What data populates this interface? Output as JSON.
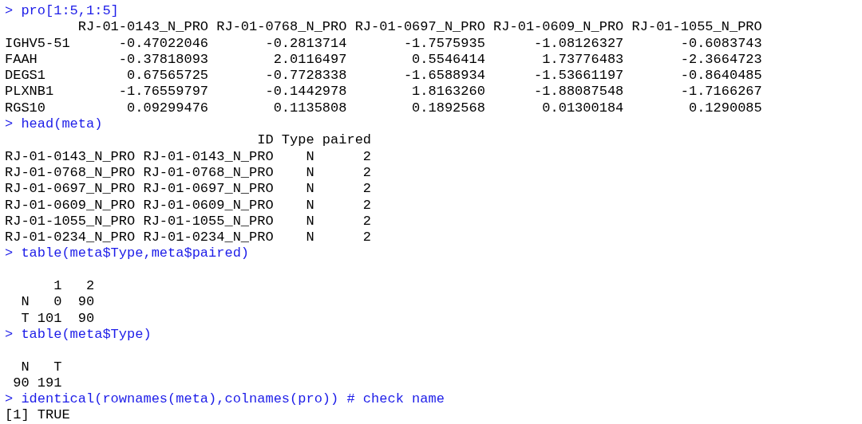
{
  "console": {
    "lines": [
      {
        "kind": "input",
        "text": "> pro[1:5,1:5]"
      },
      {
        "kind": "output",
        "text": "         RJ-01-0143_N_PRO RJ-01-0768_N_PRO RJ-01-0697_N_PRO RJ-01-0609_N_PRO RJ-01-1055_N_PRO"
      },
      {
        "kind": "output",
        "text": "IGHV5-51      -0.47022046       -0.2813714       -1.7575935      -1.08126327       -0.6083743"
      },
      {
        "kind": "output",
        "text": "FAAH          -0.37818093        2.0116497        0.5546414       1.73776483       -2.3664723"
      },
      {
        "kind": "output",
        "text": "DEGS1          0.67565725       -0.7728338       -1.6588934      -1.53661197       -0.8640485"
      },
      {
        "kind": "output",
        "text": "PLXNB1        -1.76559797       -0.1442978        1.8163260      -1.88087548       -1.7166267"
      },
      {
        "kind": "output",
        "text": "RGS10          0.09299476        0.1135808        0.1892568       0.01300184        0.1290085"
      },
      {
        "kind": "input",
        "text": "> head(meta)"
      },
      {
        "kind": "output",
        "text": "                               ID Type paired"
      },
      {
        "kind": "output",
        "text": "RJ-01-0143_N_PRO RJ-01-0143_N_PRO    N      2"
      },
      {
        "kind": "output",
        "text": "RJ-01-0768_N_PRO RJ-01-0768_N_PRO    N      2"
      },
      {
        "kind": "output",
        "text": "RJ-01-0697_N_PRO RJ-01-0697_N_PRO    N      2"
      },
      {
        "kind": "output",
        "text": "RJ-01-0609_N_PRO RJ-01-0609_N_PRO    N      2"
      },
      {
        "kind": "output",
        "text": "RJ-01-1055_N_PRO RJ-01-1055_N_PRO    N      2"
      },
      {
        "kind": "output",
        "text": "RJ-01-0234_N_PRO RJ-01-0234_N_PRO    N      2"
      },
      {
        "kind": "input",
        "text": "> table(meta$Type,meta$paired)"
      },
      {
        "kind": "blank"
      },
      {
        "kind": "output",
        "text": "      1   2"
      },
      {
        "kind": "output",
        "text": "  N   0  90"
      },
      {
        "kind": "output",
        "text": "  T 101  90"
      },
      {
        "kind": "input",
        "text": "> table(meta$Type)"
      },
      {
        "kind": "blank"
      },
      {
        "kind": "output",
        "text": "  N   T"
      },
      {
        "kind": "output",
        "text": " 90 191"
      },
      {
        "kind": "input",
        "text": "> identical(rownames(meta),colnames(pro)) # check name"
      },
      {
        "kind": "output",
        "text": "[1] TRUE"
      }
    ]
  }
}
